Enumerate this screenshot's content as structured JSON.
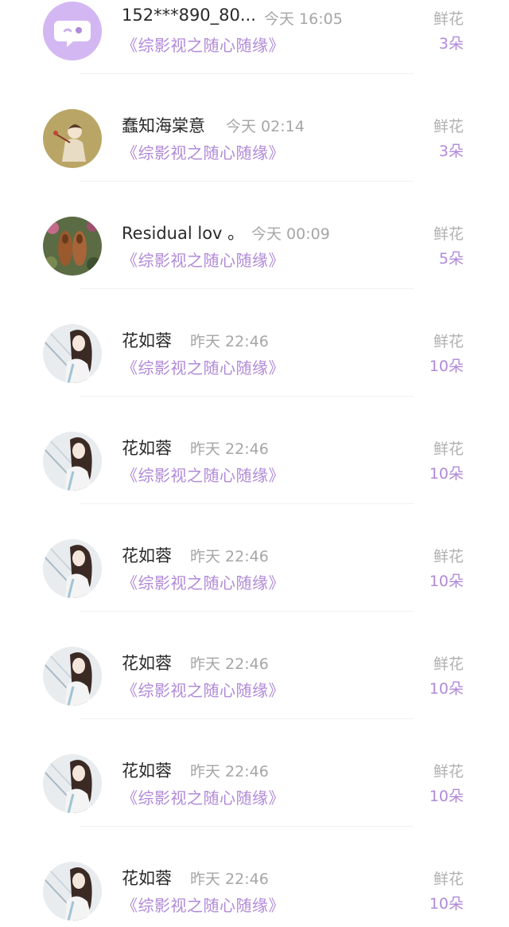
{
  "colors": {
    "accent_purple": "#b18ad8",
    "text_dark": "#2a2a2a",
    "text_gray": "#a6a6a6",
    "divider": "#f1f1f1"
  },
  "records": [
    {
      "name": "152***890_80...",
      "time": "今天 16:05",
      "book": "《综影视之随心随缘》",
      "gift_label": "鲜花",
      "gift_count": "3朵",
      "avatar": "purple-chat-bubble-avatar"
    },
    {
      "name": "蠢知海棠意",
      "time": "今天 02:14",
      "book": "《综影视之随心随缘》",
      "gift_label": "鲜花",
      "gift_count": "3朵",
      "avatar": "illustrated-girl-olive-avatar"
    },
    {
      "name": "Residual lov 。",
      "time": "今天 00:09",
      "book": "《综影视之随心随缘》",
      "gift_label": "鲜花",
      "gift_count": "5朵",
      "avatar": "shoes-photo-avatar"
    },
    {
      "name": "花如蓉",
      "time": "昨天 22:46",
      "book": "《综影视之随心随缘》",
      "gift_label": "鲜花",
      "gift_count": "10朵",
      "avatar": "anime-girl-avatar"
    },
    {
      "name": "花如蓉",
      "time": "昨天 22:46",
      "book": "《综影视之随心随缘》",
      "gift_label": "鲜花",
      "gift_count": "10朵",
      "avatar": "anime-girl-avatar"
    },
    {
      "name": "花如蓉",
      "time": "昨天 22:46",
      "book": "《综影视之随心随缘》",
      "gift_label": "鲜花",
      "gift_count": "10朵",
      "avatar": "anime-girl-avatar"
    },
    {
      "name": "花如蓉",
      "time": "昨天 22:46",
      "book": "《综影视之随心随缘》",
      "gift_label": "鲜花",
      "gift_count": "10朵",
      "avatar": "anime-girl-avatar"
    },
    {
      "name": "花如蓉",
      "time": "昨天 22:46",
      "book": "《综影视之随心随缘》",
      "gift_label": "鲜花",
      "gift_count": "10朵",
      "avatar": "anime-girl-avatar"
    },
    {
      "name": "花如蓉",
      "time": "昨天 22:46",
      "book": "《综影视之随心随缘》",
      "gift_label": "鲜花",
      "gift_count": "10朵",
      "avatar": "anime-girl-avatar"
    }
  ]
}
